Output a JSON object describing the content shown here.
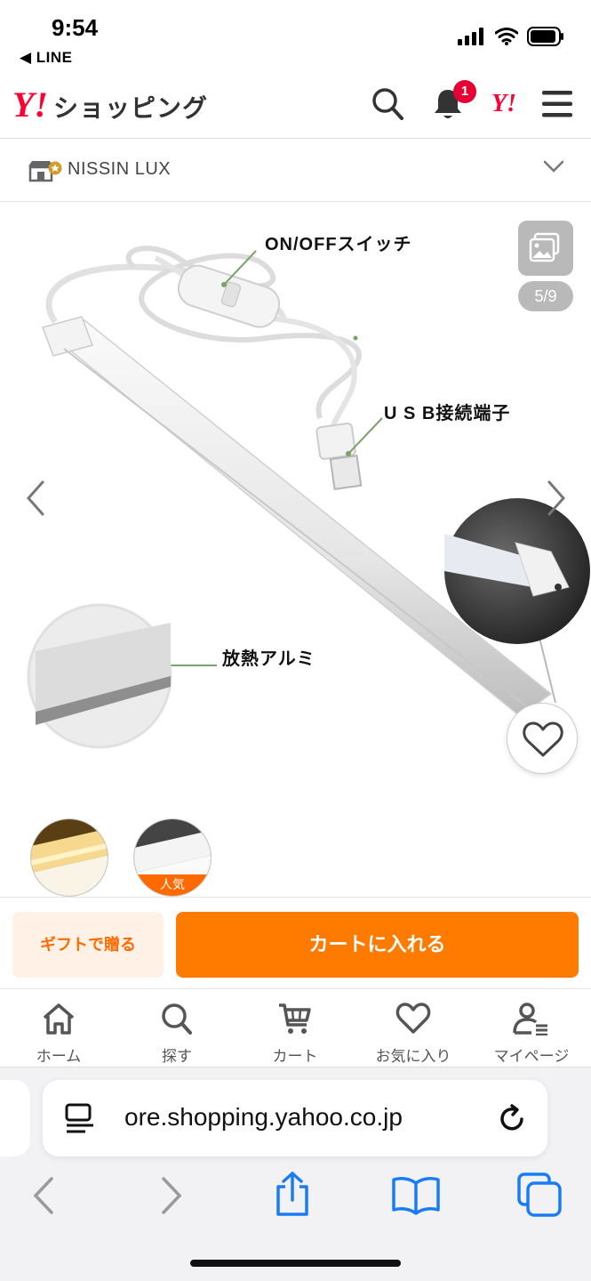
{
  "status": {
    "time": "9:54",
    "back_app": "◀ LINE"
  },
  "header": {
    "logo_mark": "Y!",
    "logo_text": "ショッピング",
    "notification_count": "1",
    "yahoo_mark": "Y!"
  },
  "store": {
    "name": "NISSIN LUX"
  },
  "product": {
    "image_counter": "5/9",
    "callouts": {
      "switch": "ON/OFFスイッチ",
      "usb": "U S B接続端子",
      "aluminum": "放熱アルミ"
    },
    "variants": [
      {
        "label": ""
      },
      {
        "label": "人気"
      }
    ]
  },
  "actions": {
    "gift_label": "ギフトで贈る",
    "cart_label": "カートに入れる"
  },
  "tabbar": {
    "items": [
      {
        "label": "ホーム",
        "icon": "home-icon"
      },
      {
        "label": "探す",
        "icon": "search-icon"
      },
      {
        "label": "カート",
        "icon": "cart-icon"
      },
      {
        "label": "お気に入り",
        "icon": "heart-icon"
      },
      {
        "label": "マイページ",
        "icon": "user-icon"
      }
    ]
  },
  "browser": {
    "url": "ore.shopping.yahoo.co.jp"
  },
  "colors": {
    "accent": "#ff7b00",
    "brand": "#ff0033",
    "badge": "#e60033",
    "link_blue": "#1a7cf5"
  }
}
